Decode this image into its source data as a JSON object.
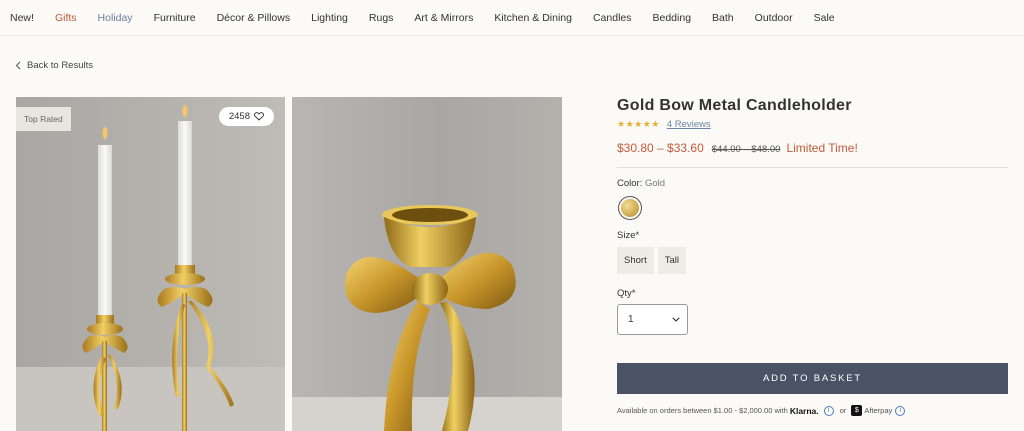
{
  "nav": {
    "items": [
      "New!",
      "Gifts",
      "Holiday",
      "Furniture",
      "Décor & Pillows",
      "Lighting",
      "Rugs",
      "Art & Mirrors",
      "Kitchen & Dining",
      "Candles",
      "Bedding",
      "Bath",
      "Outdoor",
      "Sale"
    ]
  },
  "back_label": "Back to Results",
  "gallery": {
    "tag": "Top Rated",
    "wishlist_count": "2458"
  },
  "product": {
    "title": "Gold Bow Metal Candleholder",
    "stars": "★★★★★",
    "rating_value": 5,
    "reviews": "4 Reviews",
    "price": "$30.80 – $33.60",
    "old_price": "$44.00 – $48.00",
    "promo": "Limited Time!",
    "color_label": "Color:",
    "color_value": "Gold",
    "size_label": "Size*",
    "sizes": [
      "Short",
      "Tall"
    ],
    "qty_label": "Qty*",
    "qty_value": "1",
    "basket_label": "ADD TO BASKET",
    "finance_text": "Available on orders between $1.00 - $2,000.00 with",
    "klarna": "Klarna.",
    "or": "or",
    "afterpay": "Afterpay"
  },
  "colors": {
    "accent_red": "#c45a3c",
    "basket": "#4a5366",
    "link": "#6b85a8",
    "star": "#e6b030"
  }
}
